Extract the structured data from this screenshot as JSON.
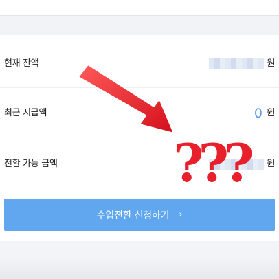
{
  "rows": [
    {
      "label": "현재 잔액",
      "unit": "원"
    },
    {
      "label": "최근 지급액",
      "value": "0",
      "unit": "원"
    },
    {
      "label": "전환 가능 금액",
      "unit": "원"
    }
  ],
  "annotation": {
    "marks": "???"
  },
  "button": {
    "label": "수입전환 신청하기",
    "chevron": "›"
  },
  "colors": {
    "accent": "#61a7ef",
    "value_blue": "#5b9ae6",
    "annotation_red": "#e8202c"
  },
  "icons": {
    "arrow": "red-arrow-icon",
    "chevron": "chevron-right-icon"
  }
}
